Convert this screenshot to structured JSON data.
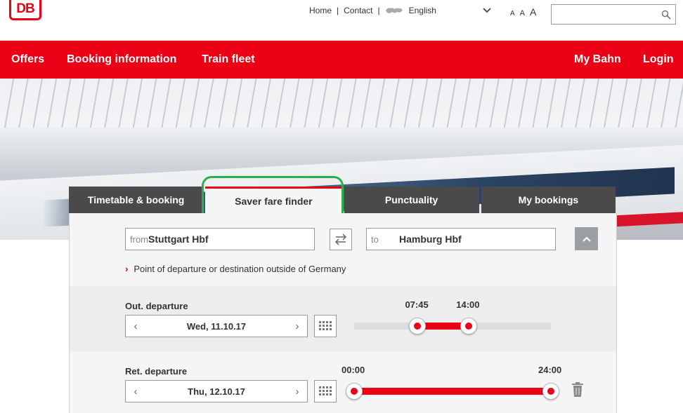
{
  "header": {
    "logo_text": "DB",
    "links": [
      "Home",
      "Contact"
    ],
    "language": "English",
    "font_size_options": [
      "A",
      "A",
      "A"
    ],
    "search": {
      "placeholder": ""
    }
  },
  "nav": {
    "left": [
      "Offers",
      "Booking information",
      "Train fleet"
    ],
    "right": [
      "My Bahn",
      "Login"
    ]
  },
  "tabs": [
    {
      "label": "Timetable & booking",
      "active": false
    },
    {
      "label": "Saver fare finder",
      "active": true
    },
    {
      "label": "Punctuality",
      "active": false
    },
    {
      "label": "My bookings",
      "active": false
    }
  ],
  "form": {
    "from_prefix": "from",
    "from_value": "Stuttgart Hbf",
    "to_prefix": "to",
    "to_value": "Hamburg Hbf",
    "outside_link": "Point of departure or destination outside of Germany",
    "outbound": {
      "label": "Out. departure",
      "date": "Wed, 11.10.17",
      "time_from": "07:45",
      "time_to": "14:00",
      "range_fraction": [
        0.323,
        0.583
      ]
    },
    "return": {
      "label": "Ret. departure",
      "date": "Thu, 12.10.17",
      "time_from": "00:00",
      "time_to": "24:00",
      "range_fraction": [
        0,
        1
      ]
    }
  },
  "colors": {
    "brand": "#ec0016",
    "highlight": "#2ab04a",
    "tab_dark": "#4a4a4a"
  }
}
